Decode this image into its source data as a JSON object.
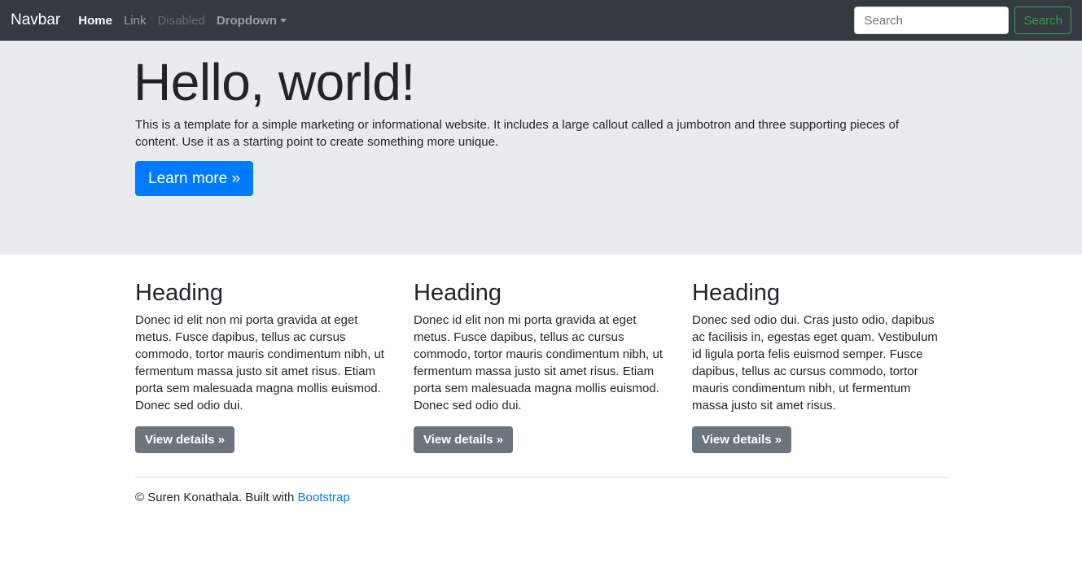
{
  "navbar": {
    "brand": "Navbar",
    "links": [
      {
        "label": "Home"
      },
      {
        "label": "Link"
      },
      {
        "label": "Disabled"
      },
      {
        "label": "Dropdown"
      }
    ],
    "search": {
      "placeholder": "Search",
      "button_label": "Search"
    },
    "background": "#343a40"
  },
  "jumbotron": {
    "title": "Hello, world!",
    "text": "This is a template for a simple marketing or informational website. It includes a large callout called a jumbotron and three supporting pieces of content. Use it as a starting point to create something more unique.",
    "button_label": "Learn more »",
    "background": "#e9ecef",
    "button_color": "#007bff"
  },
  "columns": [
    {
      "heading": "Heading",
      "text": "Donec id elit non mi porta gravida at eget metus. Fusce dapibus, tellus ac cursus commodo, tortor mauris condimentum nibh, ut fermentum massa justo sit amet risus. Etiam porta sem malesuada magna mollis euismod. Donec sed odio dui.",
      "button_label": "View details »"
    },
    {
      "heading": "Heading",
      "text": "Donec id elit non mi porta gravida at eget metus. Fusce dapibus, tellus ac cursus commodo, tortor mauris condimentum nibh, ut fermentum massa justo sit amet risus. Etiam porta sem malesuada magna mollis euismod. Donec sed odio dui.",
      "button_label": "View details »"
    },
    {
      "heading": "Heading",
      "text": "Donec sed odio dui. Cras justo odio, dapibus ac facilisis in, egestas eget quam. Vestibulum id ligula porta felis euismod semper. Fusce dapibus, tellus ac cursus commodo, tortor mauris condimentum nibh, ut fermentum massa justo sit amet risus.",
      "button_label": "View details »"
    }
  ],
  "footer": {
    "text": "© Suren Konathala. Built with",
    "link_label": "Bootstrap"
  }
}
